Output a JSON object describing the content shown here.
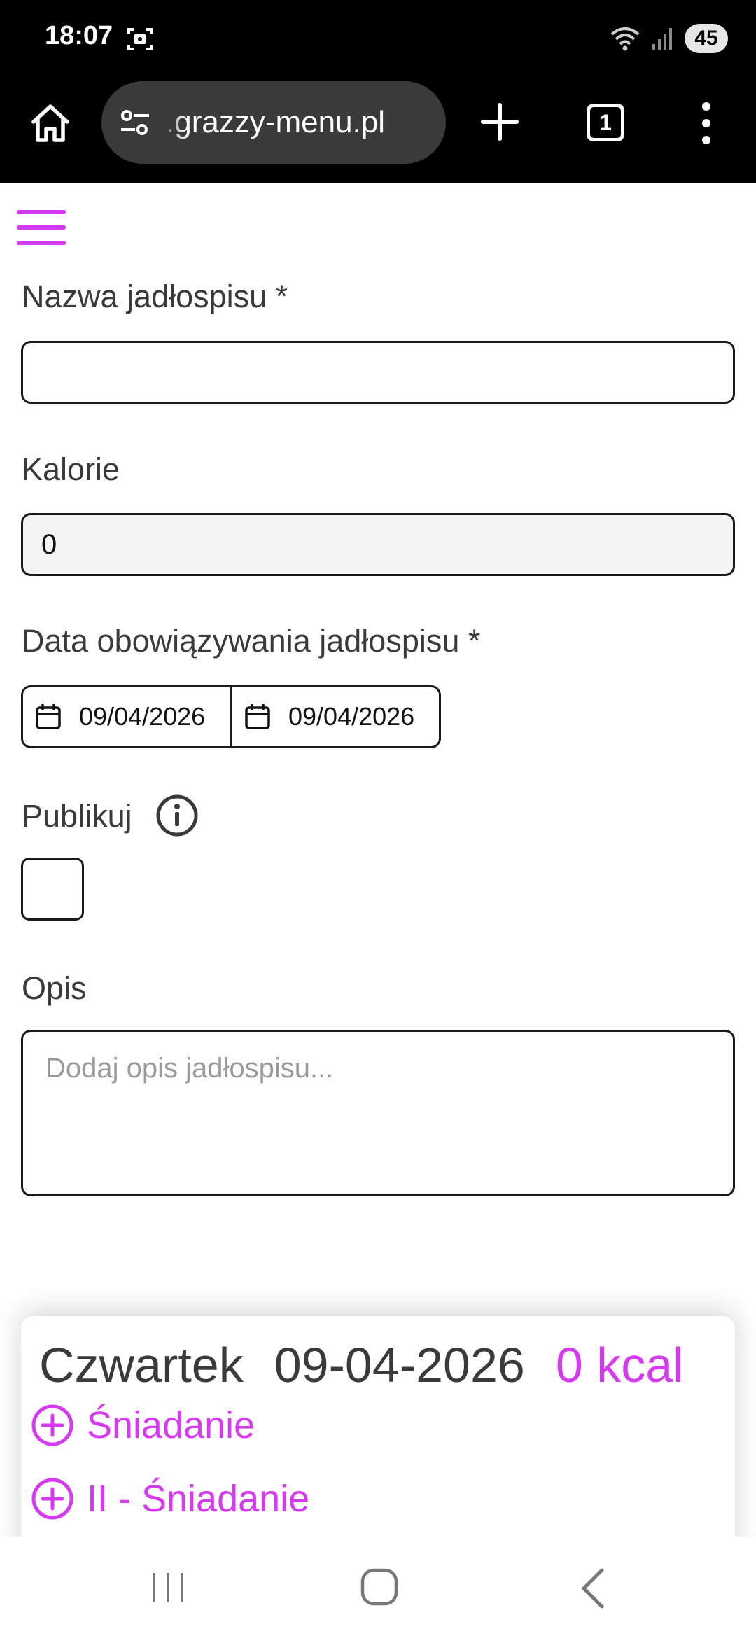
{
  "status_bar": {
    "time": "18:07",
    "battery": "45",
    "icons": [
      "screen-record-icon",
      "wifi-icon",
      "signal-icon"
    ]
  },
  "browser": {
    "url": ".grazzy-menu.pl",
    "tab_count": "1",
    "icons": [
      "home-icon",
      "tune-icon",
      "plus-icon",
      "more-vert-icon"
    ]
  },
  "form": {
    "name_label": "Nazwa jadłospisu *",
    "name_value": "",
    "calories_label": "Kalorie",
    "calories_value": "0",
    "date_label": "Data obowiązywania jadłospisu *",
    "date_from": "09/04/2026",
    "date_to": "09/04/2026",
    "publish_label": "Publikuj",
    "publish_checked": false,
    "description_label": "Opis",
    "description_placeholder": "Dodaj opis jadłospisu..."
  },
  "day_card": {
    "day_name": "Czwartek",
    "date": "09-04-2026",
    "kcal": "0 kcal",
    "meals": [
      {
        "label": "Śniadanie"
      },
      {
        "label": "II - Śniadanie"
      }
    ]
  },
  "colors": {
    "accent": "#d63af0",
    "text": "#3a3a3a",
    "browser_bg": "#000000",
    "url_pill": "#3a3a3a"
  }
}
